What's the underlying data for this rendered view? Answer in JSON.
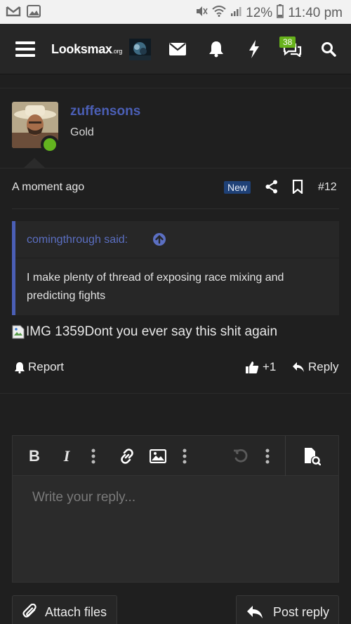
{
  "statusbar": {
    "battery": "12%",
    "time": "11:40 pm"
  },
  "navbar": {
    "logo_main": "Looksmax",
    "logo_suffix": ".org",
    "notification_count": "38"
  },
  "post": {
    "username": "zuffensons",
    "user_title": "Gold",
    "timestamp": "A moment ago",
    "new_badge": "New",
    "post_number": "#12",
    "quote": {
      "author": "comingthrough said:",
      "text": "I make plenty of thread of exposing race mixing and predicting fights"
    },
    "image_alt": "IMG 1359",
    "message": "Dont you ever say this shit again",
    "actions": {
      "report": "Report",
      "like_count": "+1",
      "reply": "Reply"
    }
  },
  "editor": {
    "placeholder": "Write your reply..."
  },
  "buttons": {
    "attach": "Attach files",
    "post_reply": "Post reply"
  },
  "colors": {
    "accent": "#4b5fb6",
    "online": "#63b31f",
    "badge_green": "#67b21b",
    "new_badge": "#1f4177"
  }
}
